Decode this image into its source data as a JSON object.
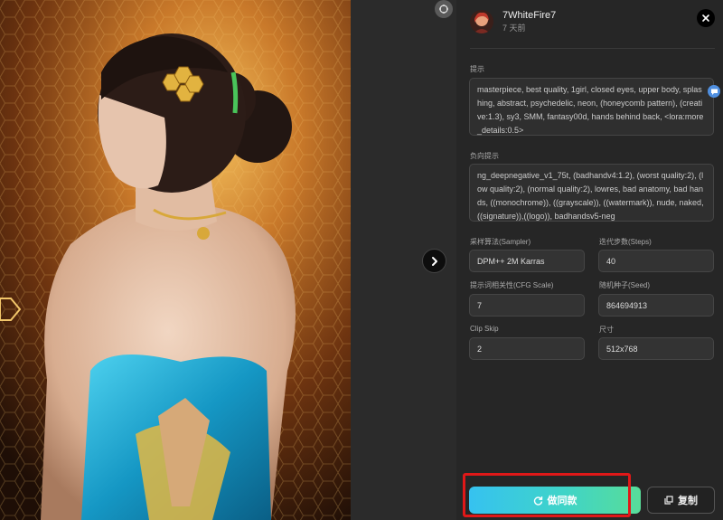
{
  "viewer": {
    "image_alt": "Artwork: woman with updo hair, seen from behind, in a blue dress with gold honeycomb accents",
    "next_icon": "chevron-right-icon",
    "corner_icon": "expand-icon"
  },
  "author": {
    "name": "7WhiteFire7",
    "time": "7 天前"
  },
  "prompt": {
    "label": "提示",
    "text": "masterpiece, best quality, 1girl, closed eyes, upper body, splashing, abstract, psychedelic, neon, (honeycomb pattern), (creative:1.3), sy3, SMM, fantasy00d, hands behind back, <lora:more_details:0.5>"
  },
  "negative_prompt": {
    "label": "负向提示",
    "text": "ng_deepnegative_v1_75t, (badhandv4:1.2), (worst quality:2), (low quality:2), (normal quality:2), lowres, bad anatomy, bad hands, ((monochrome)), ((grayscale)), ((watermark)), nude, naked, ((signature)),((logo)), badhandsv5-neg"
  },
  "params": {
    "sampler": {
      "label": "采样算法(Sampler)",
      "value": "DPM++ 2M Karras"
    },
    "steps": {
      "label": "迭代步数(Steps)",
      "value": "40"
    },
    "cfg": {
      "label": "提示词相关性(CFG Scale)",
      "value": "7"
    },
    "seed": {
      "label": "随机种子(Seed)",
      "value": "864694913"
    },
    "clip_skip": {
      "label": "Clip Skip",
      "value": "2"
    },
    "size": {
      "label": "尺寸",
      "value": "512x768"
    }
  },
  "actions": {
    "make_same": "做同款",
    "copy": "复制"
  },
  "colors": {
    "accent_start": "#36c2f0",
    "accent_end": "#58dd99",
    "highlight": "#e01818"
  }
}
